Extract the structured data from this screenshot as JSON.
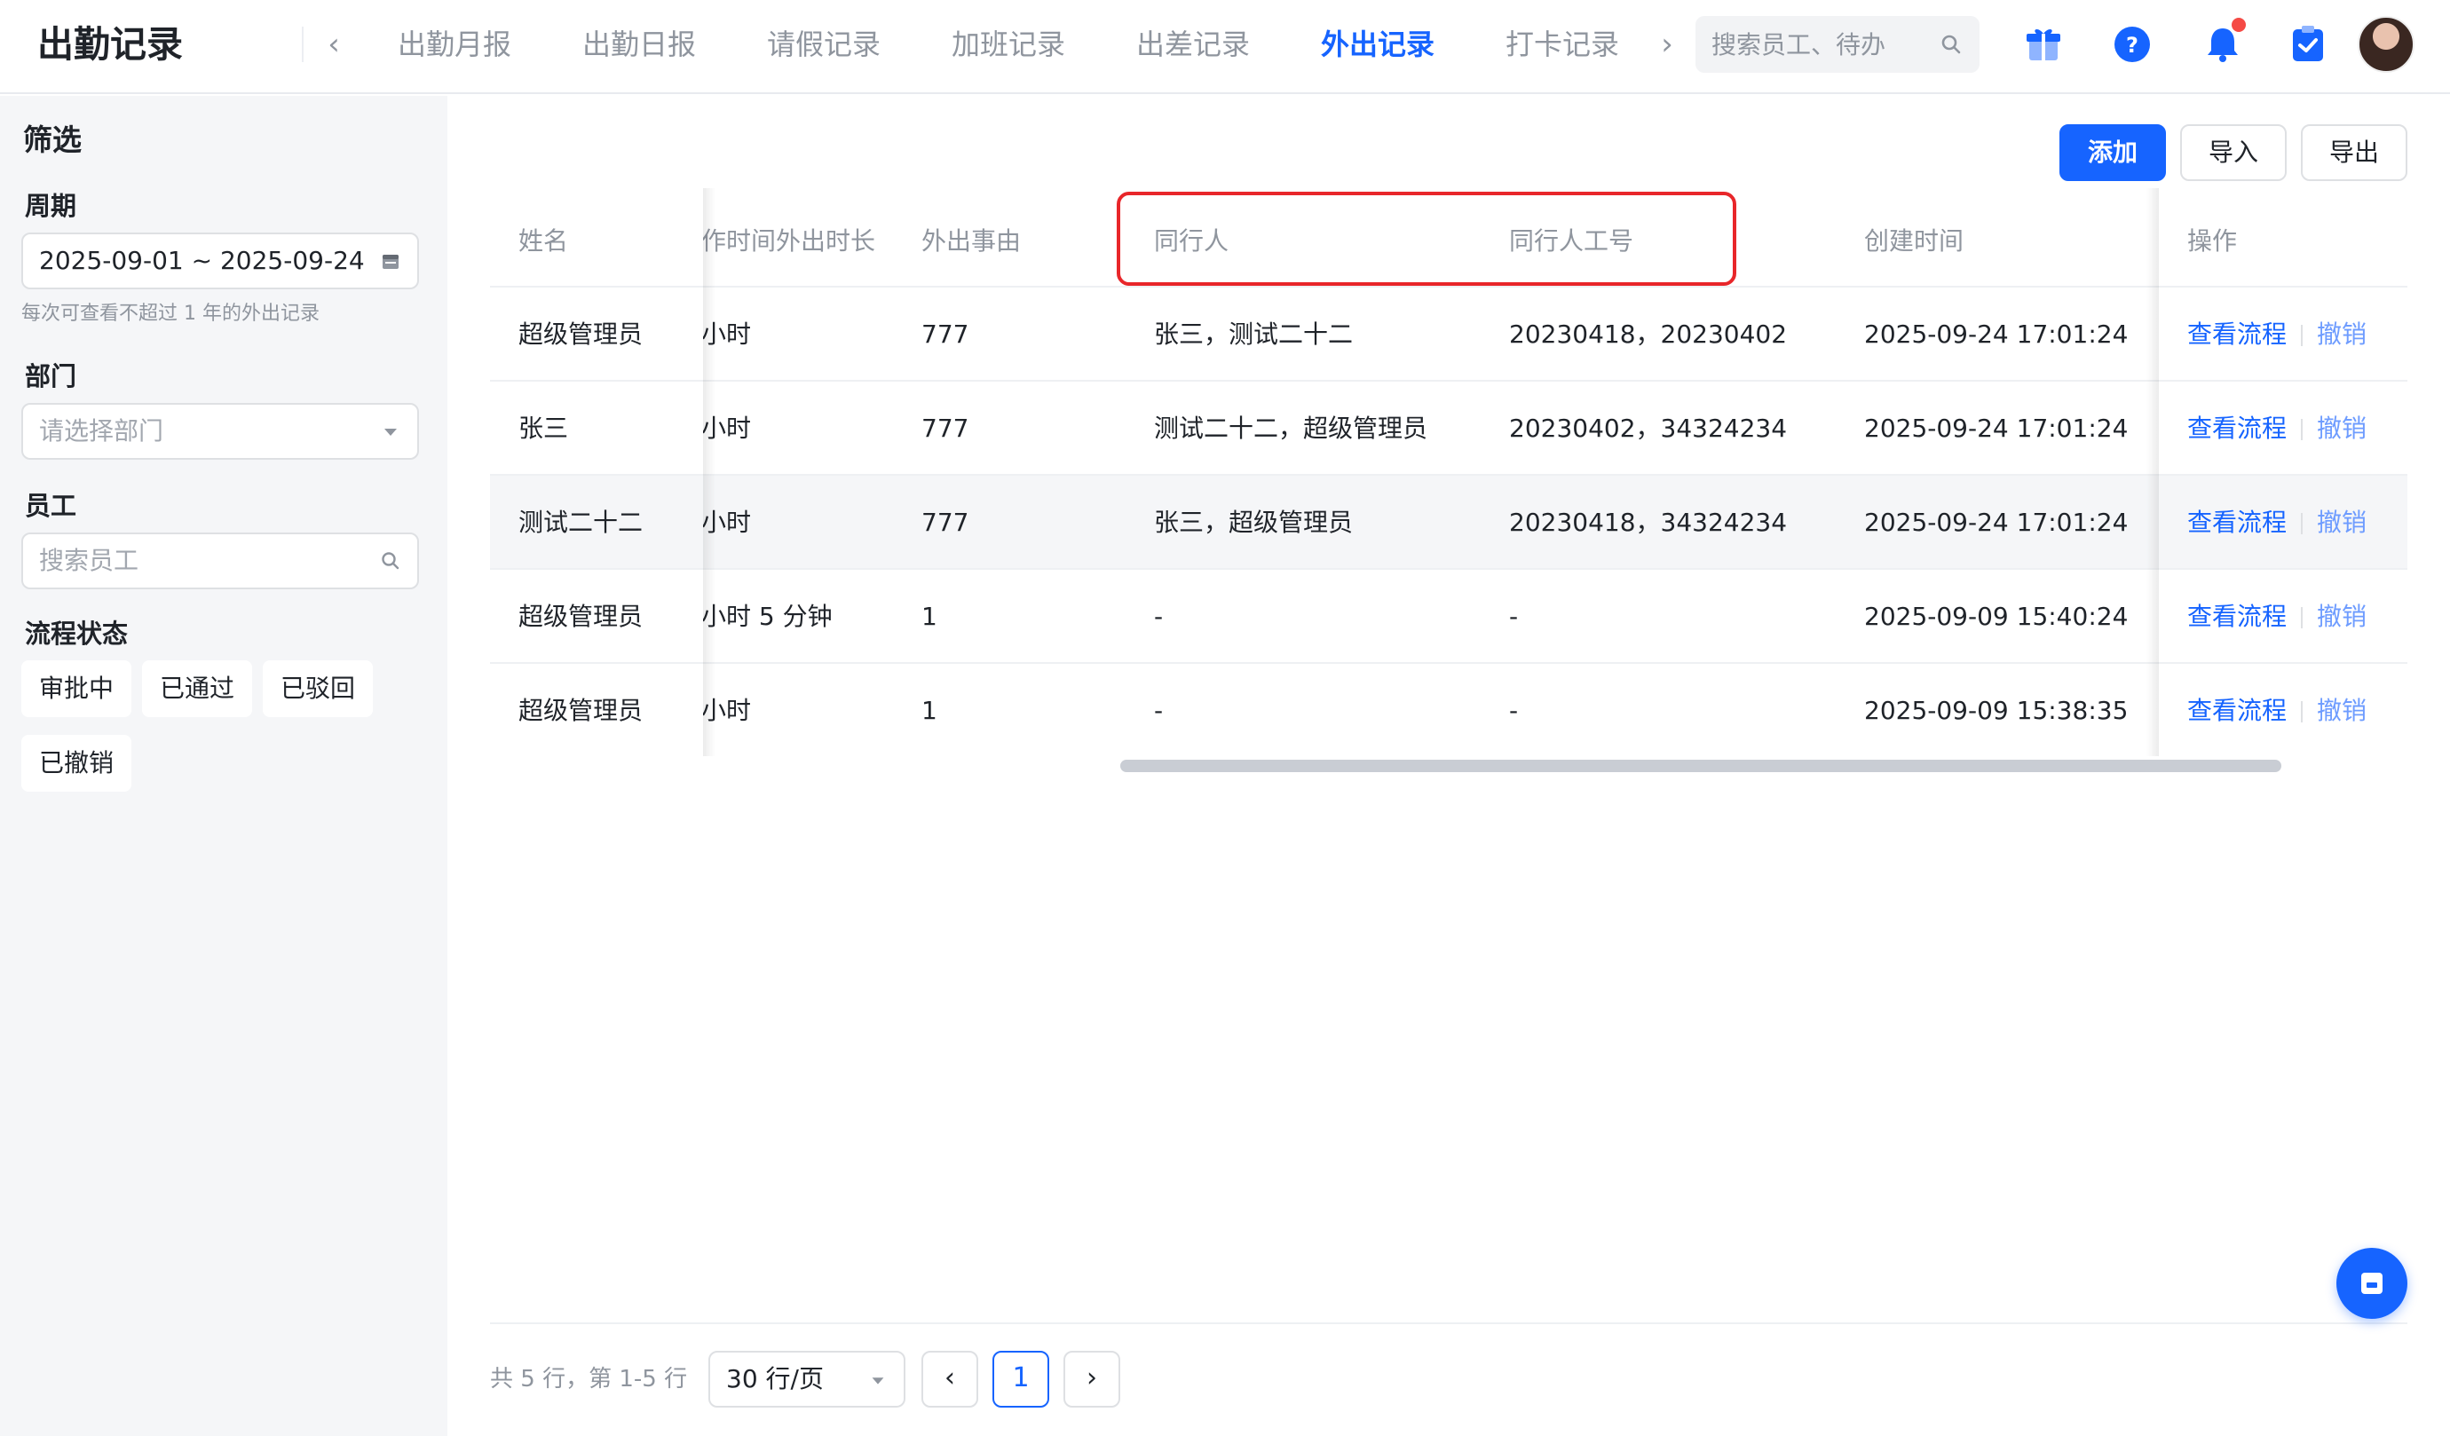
{
  "app": {
    "title": "出勤记录"
  },
  "nav": {
    "tabs": [
      {
        "label": "出勤月报"
      },
      {
        "label": "出勤日报"
      },
      {
        "label": "请假记录"
      },
      {
        "label": "加班记录"
      },
      {
        "label": "出差记录"
      },
      {
        "label": "外出记录",
        "active": true
      },
      {
        "label": "打卡记录"
      }
    ]
  },
  "search": {
    "placeholder": "搜索员工、待办"
  },
  "sidebar": {
    "title": "筛选",
    "period_label": "周期",
    "period_value": "2025-09-01 ~ 2025-09-24",
    "period_hint": "每次可查看不超过 1 年的外出记录",
    "dept_label": "部门",
    "dept_placeholder": "请选择部门",
    "employee_label": "员工",
    "employee_placeholder": "搜索员工",
    "status_label": "流程状态",
    "statuses": [
      "审批中",
      "已通过",
      "已驳回",
      "已撤销"
    ]
  },
  "toolbar": {
    "add": "添加",
    "import": "导入",
    "export": "导出"
  },
  "table": {
    "headers": {
      "name": "姓名",
      "duration": "作时间外出时长",
      "reason": "外出事由",
      "companions": "同行人",
      "companion_ids": "同行人工号",
      "created": "创建时间",
      "actions": "操作"
    },
    "rows": [
      {
        "name": "超级管理员",
        "duration": "小时",
        "reason": "777",
        "companions": "张三，测试二十二",
        "companion_ids": "20230418，20230402",
        "created": "2025-09-24 17:01:24"
      },
      {
        "name": "张三",
        "duration": "小时",
        "reason": "777",
        "companions": "测试二十二，超级管理员",
        "companion_ids": "20230402，34324234",
        "created": "2025-09-24 17:01:24"
      },
      {
        "name": "测试二十二",
        "duration": "小时",
        "reason": "777",
        "companions": "张三，超级管理员",
        "companion_ids": "20230418，34324234",
        "created": "2025-09-24 17:01:24"
      },
      {
        "name": "超级管理员",
        "duration": "小时 5 分钟",
        "reason": "1",
        "companions": "-",
        "companion_ids": "-",
        "created": "2025-09-09 15:40:24"
      },
      {
        "name": "超级管理员",
        "duration": "小时",
        "reason": "1",
        "companions": "-",
        "companion_ids": "-",
        "created": "2025-09-09 15:38:35"
      }
    ],
    "action_view": "查看流程",
    "action_revoke": "撤销"
  },
  "pagination": {
    "summary": "共 5 行，第 1-5 行",
    "page_size": "30 行/页",
    "prev": "‹",
    "next": "›",
    "current": "1"
  },
  "colors": {
    "primary": "#1664ff",
    "highlight": "#e8262a",
    "muted": "#8f959e"
  }
}
